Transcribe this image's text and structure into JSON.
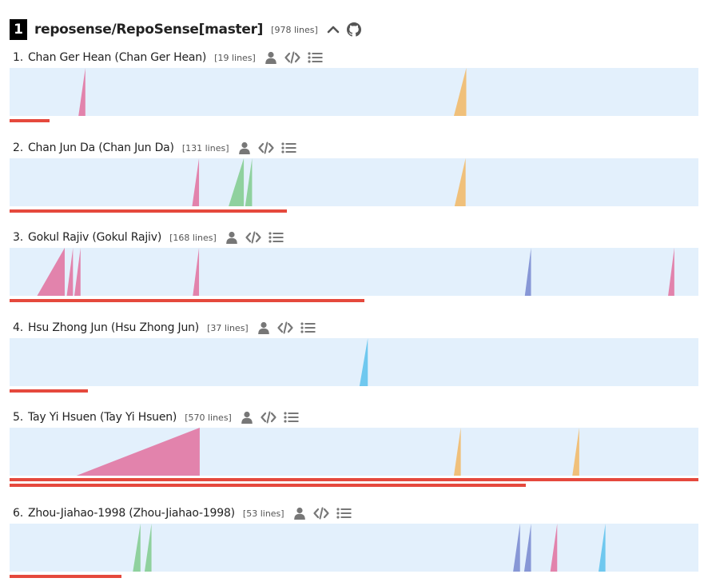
{
  "repo": {
    "rank": "1",
    "name": "reposense/RepoSense[master]",
    "lines": "[978 lines]",
    "icons": [
      "chevron-up-icon",
      "github-icon"
    ]
  },
  "author_icons": [
    "person-icon",
    "code-icon",
    "list-icon"
  ],
  "colors": {
    "ramp_background": "#e3f0fc",
    "contribution_bar": "#e5493d",
    "pink": "#e283ac",
    "orange": "#f0c07a",
    "green": "#8fd19e",
    "blue": "#8797d6",
    "cyan": "#6fc8ef"
  },
  "authors": [
    {
      "rank": "1.",
      "name": "Chan Ger Hean (Chan Ger Hean)",
      "lines": "[19 lines]",
      "contribution_fraction": [
        0.058
      ],
      "ramps": [
        {
          "color": "pink",
          "position": 0.1,
          "width": 0.01,
          "height": 1.0
        },
        {
          "color": "orange",
          "position": 0.645,
          "width": 0.018,
          "height": 1.0
        }
      ]
    },
    {
      "rank": "2.",
      "name": "Chan Jun Da (Chan Jun Da)",
      "lines": "[131 lines]",
      "contribution_fraction": [
        0.402
      ],
      "ramps": [
        {
          "color": "pink",
          "position": 0.265,
          "width": 0.01,
          "height": 1.0
        },
        {
          "color": "green",
          "position": 0.318,
          "width": 0.022,
          "height": 1.0
        },
        {
          "color": "green",
          "position": 0.342,
          "width": 0.01,
          "height": 1.0
        },
        {
          "color": "orange",
          "position": 0.646,
          "width": 0.016,
          "height": 1.0
        }
      ]
    },
    {
      "rank": "3.",
      "name": "Gokul Rajiv (Gokul Rajiv)",
      "lines": "[168 lines]",
      "contribution_fraction": [
        0.515
      ],
      "ramps": [
        {
          "color": "pink",
          "position": 0.04,
          "width": 0.04,
          "height": 1.0
        },
        {
          "color": "pink",
          "position": 0.083,
          "width": 0.009,
          "height": 1.0
        },
        {
          "color": "pink",
          "position": 0.094,
          "width": 0.009,
          "height": 1.0
        },
        {
          "color": "pink",
          "position": 0.266,
          "width": 0.009,
          "height": 1.0
        },
        {
          "color": "blue",
          "position": 0.748,
          "width": 0.009,
          "height": 1.0
        },
        {
          "color": "pink",
          "position": 0.956,
          "width": 0.009,
          "height": 1.0
        }
      ]
    },
    {
      "rank": "4.",
      "name": "Hsu Zhong Jun (Hsu Zhong Jun)",
      "lines": "[37 lines]",
      "contribution_fraction": [
        0.114
      ],
      "ramps": [
        {
          "color": "cyan",
          "position": 0.508,
          "width": 0.012,
          "height": 1.0
        }
      ]
    },
    {
      "rank": "5.",
      "name": "Tay Yi Hsuen (Tay Yi Hsuen)",
      "lines": "[570 lines]",
      "contribution_fraction": [
        1.0,
        0.749
      ],
      "ramps": [
        {
          "color": "pink",
          "position": 0.097,
          "width": 0.179,
          "height": 1.0
        },
        {
          "color": "orange",
          "position": 0.645,
          "width": 0.01,
          "height": 1.0
        },
        {
          "color": "orange",
          "position": 0.817,
          "width": 0.01,
          "height": 1.0
        }
      ]
    },
    {
      "rank": "6.",
      "name": "Zhou-Jiahao-1998 (Zhou-Jiahao-1998)",
      "lines": "[53 lines]",
      "contribution_fraction": [
        0.162
      ],
      "ramps": [
        {
          "color": "green",
          "position": 0.179,
          "width": 0.011,
          "height": 1.0
        },
        {
          "color": "green",
          "position": 0.196,
          "width": 0.01,
          "height": 1.0
        },
        {
          "color": "blue",
          "position": 0.731,
          "width": 0.01,
          "height": 1.0
        },
        {
          "color": "blue",
          "position": 0.747,
          "width": 0.01,
          "height": 1.0
        },
        {
          "color": "pink",
          "position": 0.785,
          "width": 0.01,
          "height": 1.0
        },
        {
          "color": "cyan",
          "position": 0.855,
          "width": 0.01,
          "height": 1.0
        }
      ]
    }
  ]
}
